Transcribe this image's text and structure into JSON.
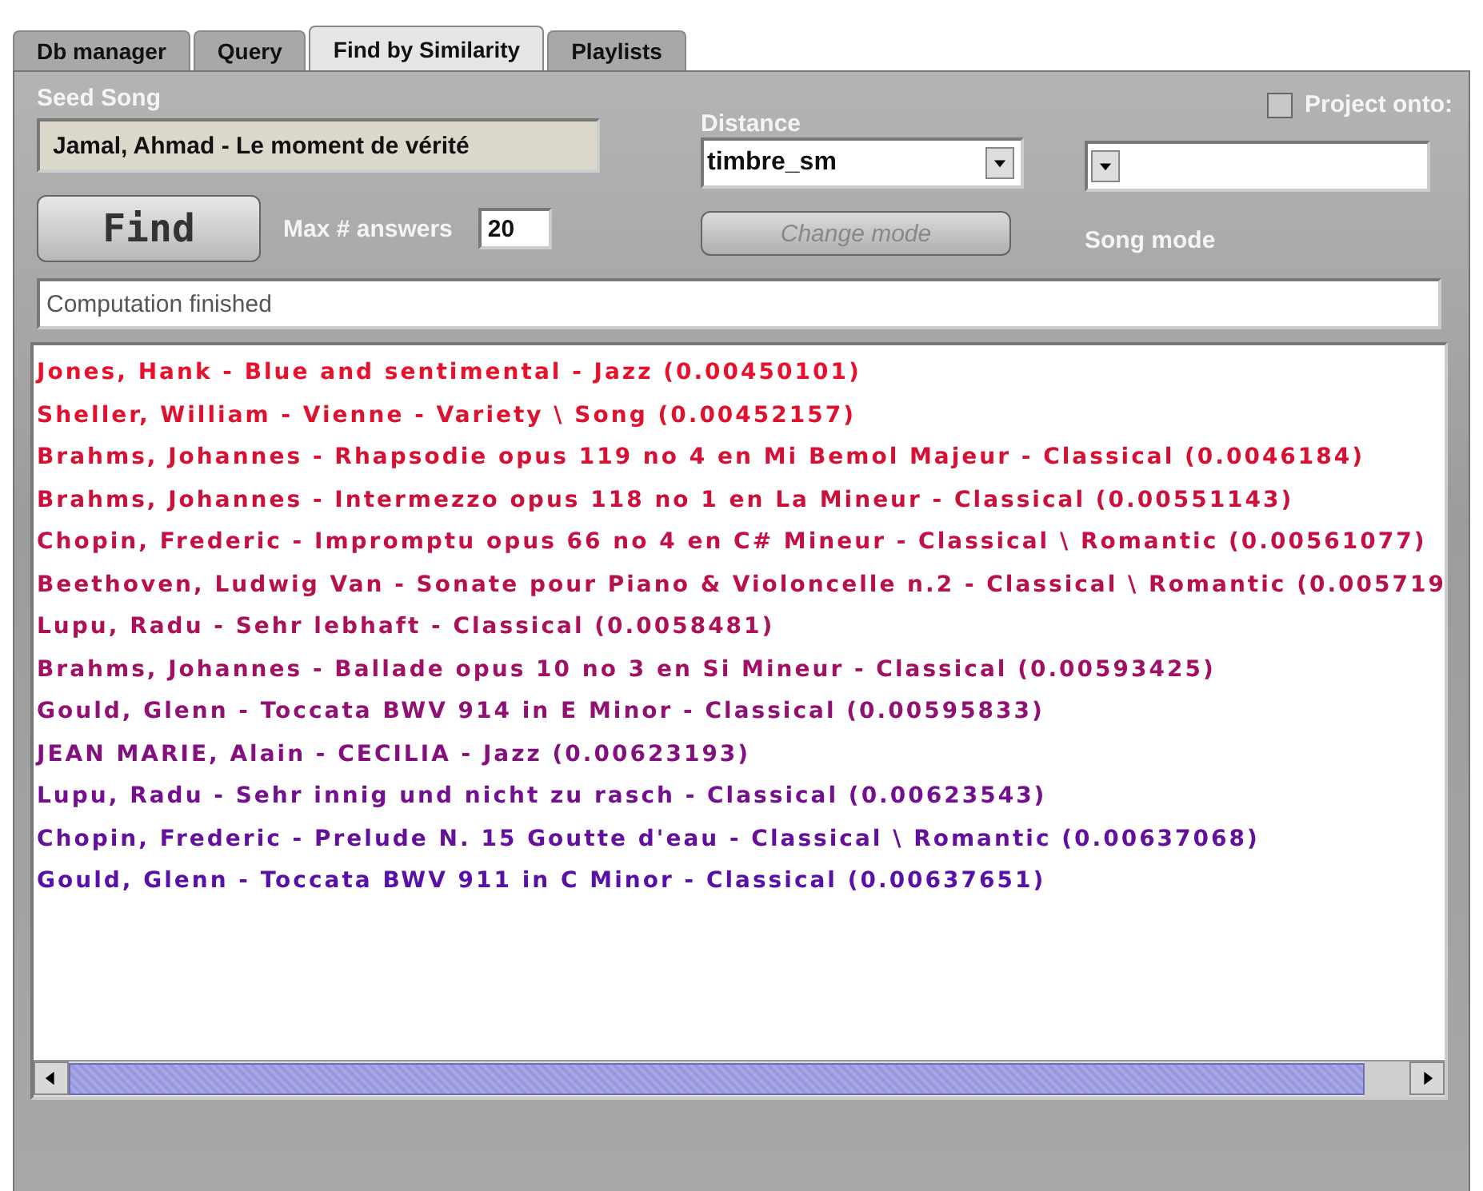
{
  "tabs": [
    {
      "label": "Db manager",
      "selected": false
    },
    {
      "label": "Query",
      "selected": false
    },
    {
      "label": "Find by Similarity",
      "selected": true
    },
    {
      "label": "Playlists",
      "selected": false
    }
  ],
  "seed_song": {
    "label": "Seed Song",
    "value": "Jamal, Ahmad - Le moment de vérité"
  },
  "distance": {
    "label": "Distance",
    "value": "timbre_sm"
  },
  "project_onto": {
    "label": "Project onto:",
    "checked": false
  },
  "find_button": "Find",
  "max_answers": {
    "label": "Max # answers",
    "value": "20"
  },
  "change_mode_button": {
    "label": "Change mode",
    "disabled": true
  },
  "mode_label": "Song mode",
  "status": "Computation finished",
  "results": [
    {
      "text": "Jones, Hank - Blue and sentimental - Jazz (0.00450101)",
      "color": "#e8102a"
    },
    {
      "text": "Sheller, William - Vienne - Variety \\ Song (0.00452157)",
      "color": "#e0102e"
    },
    {
      "text": "Brahms, Johannes - Rhapsodie opus 119 no 4 en Mi Bemol Majeur - Classical (0.0046184)",
      "color": "#d81034"
    },
    {
      "text": "Brahms, Johannes - Intermezzo opus 118 no 1 en La Mineur - Classical (0.00551143)",
      "color": "#cc103c"
    },
    {
      "text": "Chopin, Frederic - Impromptu opus 66 no 4 en C# Mineur - Classical \\ Romantic (0.00561077)",
      "color": "#c41044"
    },
    {
      "text": "Beethoven, Ludwig Van - Sonate pour Piano & Violoncelle n.2 - Classical \\ Romantic (0.005719",
      "color": "#b8104c"
    },
    {
      "text": "Lupu, Radu - Sehr lebhaft - Classical (0.0058481)",
      "color": "#ac1058"
    },
    {
      "text": "Brahms, Johannes - Ballade opus 10 no 3 en Si Mineur - Classical (0.00593425)",
      "color": "#a01064"
    },
    {
      "text": "Gould, Glenn - Toccata BWV 914 in E Minor - Classical (0.00595833)",
      "color": "#901074"
    },
    {
      "text": "JEAN MARIE, Alain - CECILIA - Jazz (0.00623193)",
      "color": "#841080"
    },
    {
      "text": "Lupu, Radu - Sehr innig und nicht zu rasch - Classical (0.00623543)",
      "color": "#741090"
    },
    {
      "text": "Chopin, Frederic - Prelude N. 15 Goutte d'eau - Classical \\ Romantic (0.00637068)",
      "color": "#64109c"
    },
    {
      "text": "Gould, Glenn - Toccata BWV 911 in C Minor - Classical (0.00637651)",
      "color": "#5810a8"
    }
  ]
}
